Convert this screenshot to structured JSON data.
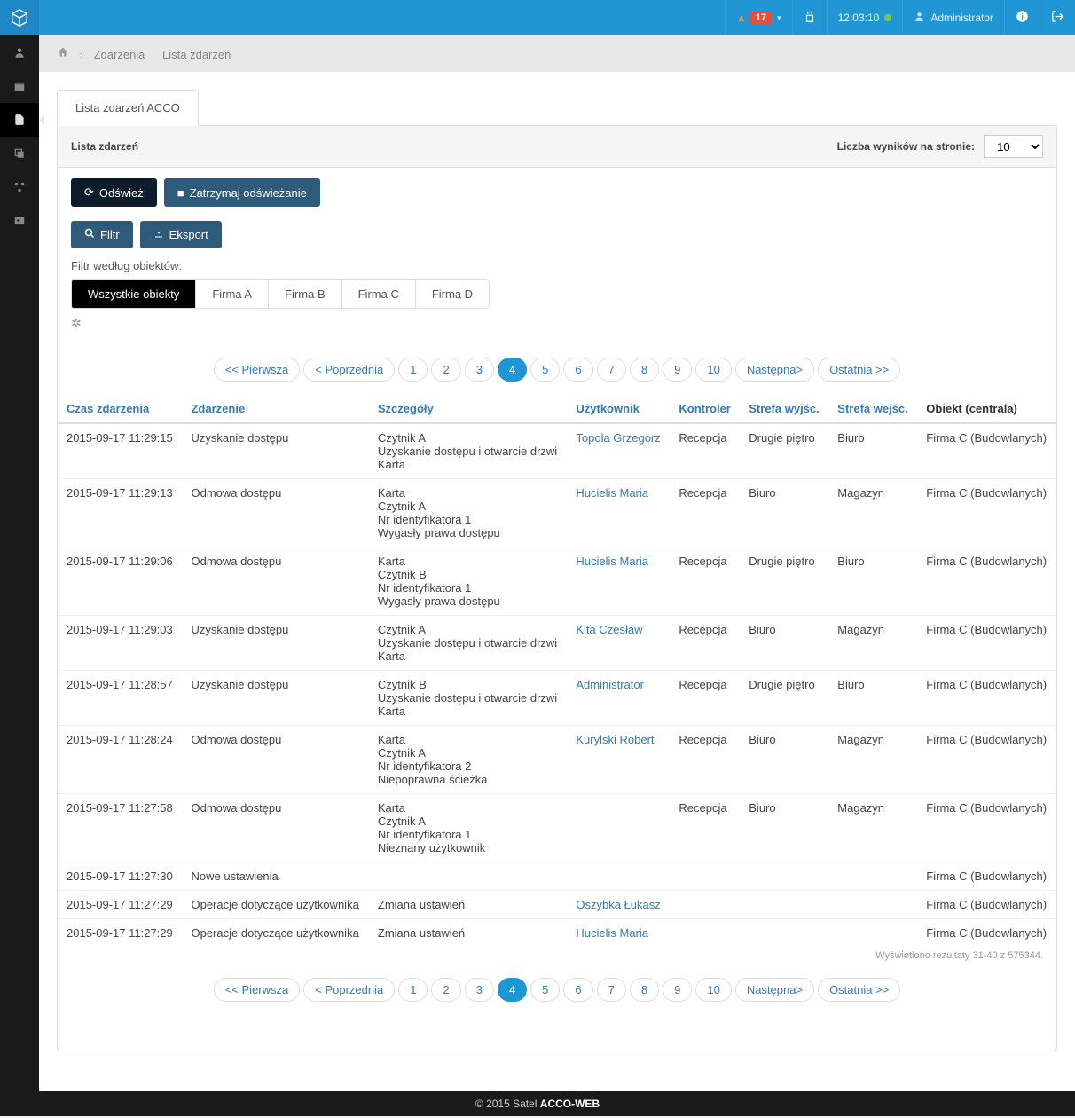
{
  "topbar": {
    "alert_count": "17",
    "time": "12:03:10",
    "user": "Administrator"
  },
  "breadcrumb": {
    "item1": "Zdarzenia",
    "item2": "Lista zdarzeń"
  },
  "panel": {
    "tab_title": "Lista zdarzeń ACCO",
    "header_title": "Lista zdarzeń",
    "results_label": "Liczba wyników na stronie:",
    "results_value": "10"
  },
  "buttons": {
    "refresh": "Odśwież",
    "stop_refresh": "Zatrzymaj odświeżanie",
    "filter": "Filtr",
    "export": "Eksport"
  },
  "filter": {
    "label": "Filtr według obiektów:",
    "tabs": [
      "Wszystkie obiekty",
      "Firma A",
      "Firma B",
      "Firma C",
      "Firma D"
    ]
  },
  "pagination": {
    "first": "<< Pierwsza",
    "prev": "< Poprzednia",
    "pages": [
      "1",
      "2",
      "3",
      "4",
      "5",
      "6",
      "7",
      "8",
      "9",
      "10"
    ],
    "active": "4",
    "next": "Następna>",
    "last": "Ostatnia >>"
  },
  "columns": {
    "time": "Czas zdarzenia",
    "event": "Zdarzenie",
    "details": "Szczegóły",
    "user": "Użytkownik",
    "controller": "Kontroler",
    "zone_out": "Strefa wyjśc.",
    "zone_in": "Strefa wejśc.",
    "object": "Obiekt (centrala)"
  },
  "rows": [
    {
      "time": "2015-09-17 11:29:15",
      "event": "Uzyskanie dostępu",
      "details": [
        "Czytnik A",
        "Uzyskanie dostępu i otwarcie drzwi",
        "Karta"
      ],
      "user": "Topola Grzegorz",
      "controller": "Recepcja",
      "out": "Drugie piętro",
      "in": "Biuro",
      "object": "Firma C (Budowlanych)"
    },
    {
      "time": "2015-09-17 11:29:13",
      "event": "Odmowa dostępu",
      "details": [
        "Karta",
        "Czytnik A",
        "Nr identyfikatora 1",
        "Wygasły prawa dostępu"
      ],
      "user": "Hucielis Maria",
      "controller": "Recepcja",
      "out": "Biuro",
      "in": "Magazyn",
      "object": "Firma C (Budowlanych)"
    },
    {
      "time": "2015-09-17 11:29:06",
      "event": "Odmowa dostępu",
      "details": [
        "Karta",
        "Czytnik B",
        "Nr identyfikatora 1",
        "Wygasły prawa dostępu"
      ],
      "user": "Hucielis Maria",
      "controller": "Recepcja",
      "out": "Drugie piętro",
      "in": "Biuro",
      "object": "Firma C (Budowlanych)"
    },
    {
      "time": "2015-09-17 11:29:03",
      "event": "Uzyskanie dostępu",
      "details": [
        "Czytnik A",
        "Uzyskanie dostępu i otwarcie drzwi",
        "Karta"
      ],
      "user": "Kita Czesław",
      "controller": "Recepcja",
      "out": "Biuro",
      "in": "Magazyn",
      "object": "Firma C (Budowlanych)"
    },
    {
      "time": "2015-09-17 11:28:57",
      "event": "Uzyskanie dostępu",
      "details": [
        "Czytnik B",
        "Uzyskanie dostępu i otwarcie drzwi",
        "Karta"
      ],
      "user": "Administrator",
      "controller": "Recepcja",
      "out": "Drugie piętro",
      "in": "Biuro",
      "object": "Firma C (Budowlanych)"
    },
    {
      "time": "2015-09-17 11:28:24",
      "event": "Odmowa dostępu",
      "details": [
        "Karta",
        "Czytnik A",
        "Nr identyfikatora 2",
        "Niepoprawna ścieżka"
      ],
      "user": "Kurylski Robert",
      "controller": "Recepcja",
      "out": "Biuro",
      "in": "Magazyn",
      "object": "Firma C (Budowlanych)"
    },
    {
      "time": "2015-09-17 11:27:58",
      "event": "Odmowa dostępu",
      "details": [
        "Karta",
        "Czytnik A",
        "Nr identyfikatora 1",
        "Nieznany użytkownik"
      ],
      "user": "",
      "controller": "Recepcja",
      "out": "Biuro",
      "in": "Magazyn",
      "object": "Firma C (Budowlanych)"
    },
    {
      "time": "2015-09-17 11:27:30",
      "event": "Nowe ustawienia",
      "details": [],
      "user": "",
      "controller": "",
      "out": "",
      "in": "",
      "object": "Firma C (Budowlanych)"
    },
    {
      "time": "2015-09-17 11:27:29",
      "event": "Operacje dotyczące użytkownika",
      "details": [
        "Zmiana ustawień"
      ],
      "user": "Oszybka Łukasz",
      "controller": "",
      "out": "",
      "in": "",
      "object": "Firma C (Budowlanych)"
    },
    {
      "time": "2015-09-17 11:27:29",
      "event": "Operacje dotyczące użytkownika",
      "details": [
        "Zmiana ustawień"
      ],
      "user": "Hucielis Maria",
      "controller": "",
      "out": "",
      "in": "",
      "object": "Firma C (Budowlanych)"
    }
  ],
  "result_info": "Wyświetlono rezultaty 31-40 z 575344.",
  "footer": {
    "copy": "© 2015 Satel ",
    "brand": "ACCO-WEB"
  }
}
